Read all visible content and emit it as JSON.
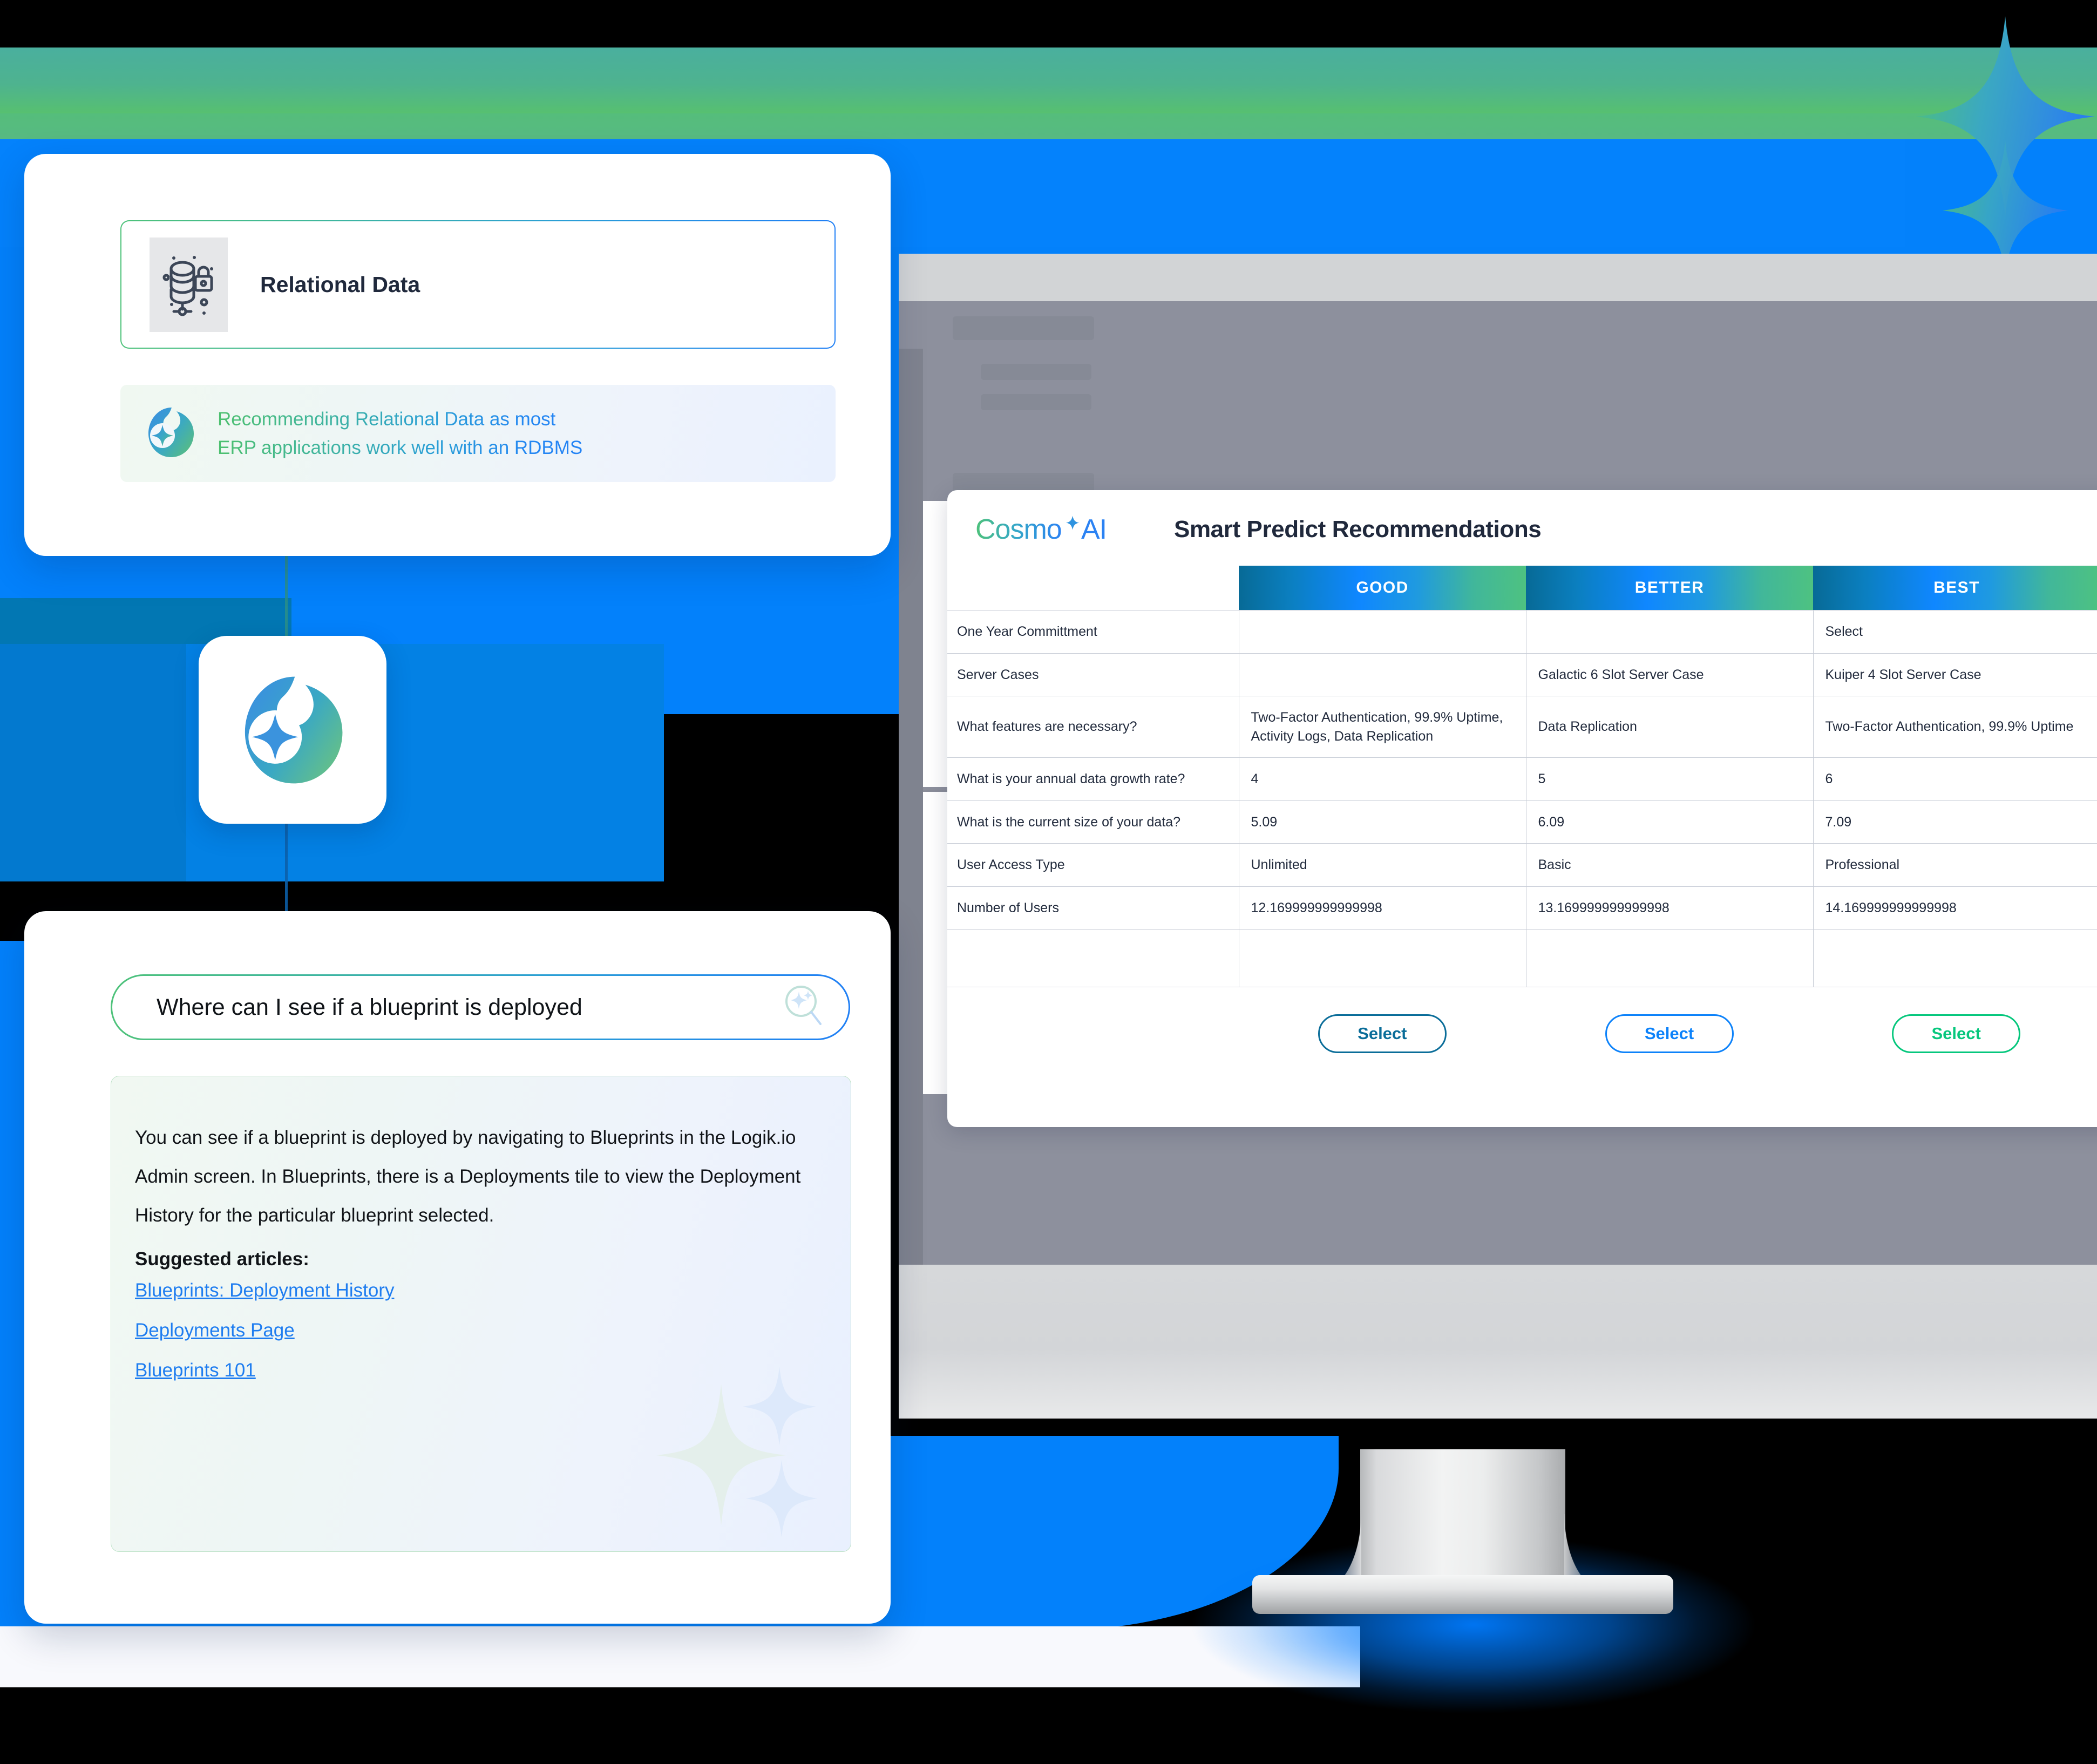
{
  "recommendation_card": {
    "tile_label": "Relational Data",
    "tile_icon": "database-lock-icon",
    "banner_icon": "cosmo-logo-icon",
    "banner_line1": "Recommending Relational Data as most",
    "banner_line2": "ERP applications work well with an RDBMS"
  },
  "app_tile": {
    "icon": "cosmo-logo-icon"
  },
  "assistant_card": {
    "search_query": "Where can I see if a blueprint is deployed",
    "search_icon": "sparkle-search-icon",
    "answer": "You can see if a blueprint is deployed by navigating to Blueprints in the Logik.io Admin screen. In Blueprints, there is a Deployments tile to view the Deployment History for the particular blueprint selected.",
    "suggested_title": "Suggested articles:",
    "suggested_links": [
      "Blueprints: Deployment History",
      "Deployments Page",
      "Blueprints 101"
    ]
  },
  "cosmo_panel": {
    "brand": "Cosmo",
    "brand_suffix": "AI",
    "title": "Smart Predict Recommendations",
    "columns": [
      "",
      "GOOD",
      "BETTER",
      "BEST"
    ],
    "rows": [
      {
        "label": "One Year Committment",
        "values": [
          "",
          "",
          "Select"
        ]
      },
      {
        "label": "Server Cases",
        "values": [
          "",
          "Galactic 6 Slot Server Case",
          "Kuiper 4 Slot Server Case"
        ]
      },
      {
        "label": "What features are necessary?",
        "values": [
          "Two-Factor Authentication, 99.9% Uptime, Activity Logs, Data Replication",
          "Data Replication",
          "Two-Factor Authentication, 99.9% Uptime"
        ]
      },
      {
        "label": "What is your annual data growth rate?",
        "values": [
          "4",
          "5",
          "6"
        ]
      },
      {
        "label": "What is the current size of your data?",
        "values": [
          "5.09",
          "6.09",
          "7.09"
        ]
      },
      {
        "label": "User Access Type",
        "values": [
          "Unlimited",
          "Basic",
          "Professional"
        ]
      },
      {
        "label": "Number of Users",
        "values": [
          "12.169999999999998",
          "13.169999999999998",
          "14.169999999999998"
        ]
      },
      {
        "label": "",
        "values": [
          "",
          "",
          ""
        ]
      }
    ],
    "buttons": [
      {
        "label": "Select",
        "variant": "good"
      },
      {
        "label": "Select",
        "variant": "better"
      },
      {
        "label": "Select",
        "variant": "best"
      }
    ]
  },
  "colors": {
    "brand_green": "#4ec27a",
    "brand_blue": "#1f7ff5",
    "accent_teal": "#0a6d99",
    "accent_bright_blue": "#0c82fa",
    "accent_green": "#06c77d",
    "page_blue": "#0381fb",
    "text_dark": "#20293c"
  }
}
